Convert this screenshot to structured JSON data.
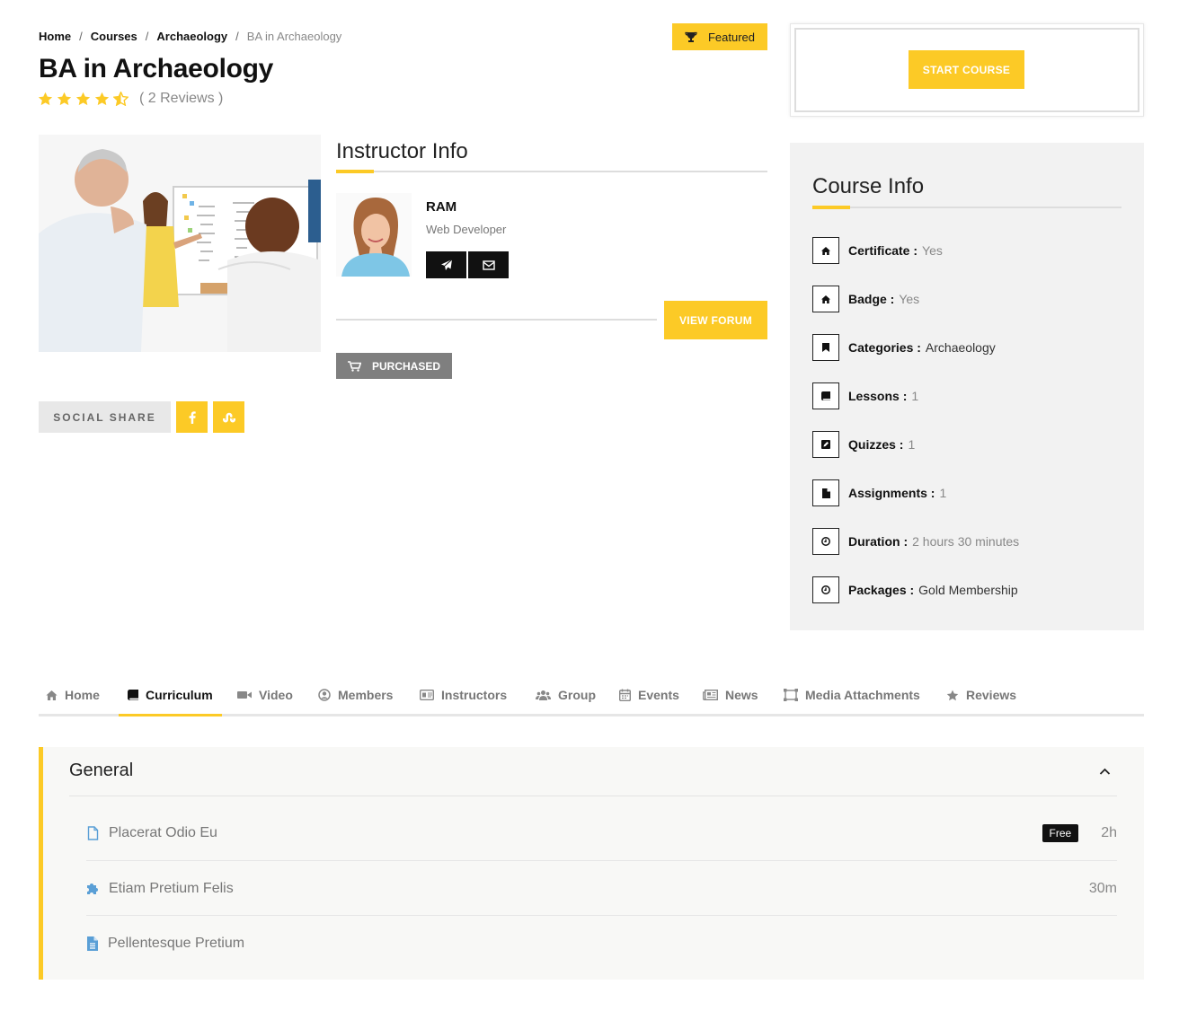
{
  "breadcrumb": {
    "items": [
      "Home",
      "Courses",
      "Archaeology",
      "BA in Archaeology"
    ],
    "separator": "/"
  },
  "featured_label": "Featured",
  "course": {
    "title": "BA in Archaeology",
    "rating": 4.5,
    "rating_max": 5,
    "reviews": "( 2 Reviews )"
  },
  "instructor": {
    "heading": "Instructor Info",
    "name": "RAM",
    "role": "Web Developer"
  },
  "view_forum_label": "VIEW FORUM",
  "purchased_label": "PURCHASED",
  "social_share_label": "SOCIAL SHARE",
  "start_course_label": "START COURSE",
  "course_info": {
    "heading": "Course Info",
    "rows": [
      {
        "key": "Certificate :",
        "value": "Yes",
        "icon": "home-icon"
      },
      {
        "key": "Badge :",
        "value": "Yes",
        "icon": "home-icon"
      },
      {
        "key": "Categories :",
        "value": "Archaeology",
        "icon": "bookmark-icon"
      },
      {
        "key": "Lessons :",
        "value": "1",
        "icon": "book-icon"
      },
      {
        "key": "Quizzes :",
        "value": "1",
        "icon": "edit-icon"
      },
      {
        "key": "Assignments :",
        "value": "1",
        "icon": "file-icon"
      },
      {
        "key": "Duration :",
        "value": "2 hours 30 minutes",
        "icon": "clock-icon"
      },
      {
        "key": "Packages :",
        "value": "Gold Membership",
        "icon": "clock-icon"
      }
    ]
  },
  "tabs": [
    {
      "label": "Home",
      "icon": "home-icon"
    },
    {
      "label": "Curriculum",
      "icon": "book-icon",
      "active": true
    },
    {
      "label": "Video",
      "icon": "video-icon"
    },
    {
      "label": "Members",
      "icon": "user-circle-icon"
    },
    {
      "label": "Instructors",
      "icon": "id-card-icon"
    },
    {
      "label": "Group",
      "icon": "users-icon"
    },
    {
      "label": "Events",
      "icon": "calendar-icon"
    },
    {
      "label": "News",
      "icon": "newspaper-icon"
    },
    {
      "label": "Media Attachments",
      "icon": "media-icon"
    },
    {
      "label": "Reviews",
      "icon": "star-icon"
    }
  ],
  "curriculum": {
    "section_title": "General",
    "units": [
      {
        "title": "Placerat Odio Eu",
        "badge": "Free",
        "duration": "2h",
        "icon": "file-outline-icon"
      },
      {
        "title": "Etiam Pretium Felis",
        "badge": "",
        "duration": "30m",
        "icon": "puzzle-icon"
      },
      {
        "title": "Pellentesque Pretium",
        "badge": "",
        "duration": "",
        "icon": "file-text-icon"
      }
    ]
  },
  "colors": {
    "accent": "#fcca26",
    "dark": "#111111",
    "link_blue": "#5a9fd6"
  }
}
